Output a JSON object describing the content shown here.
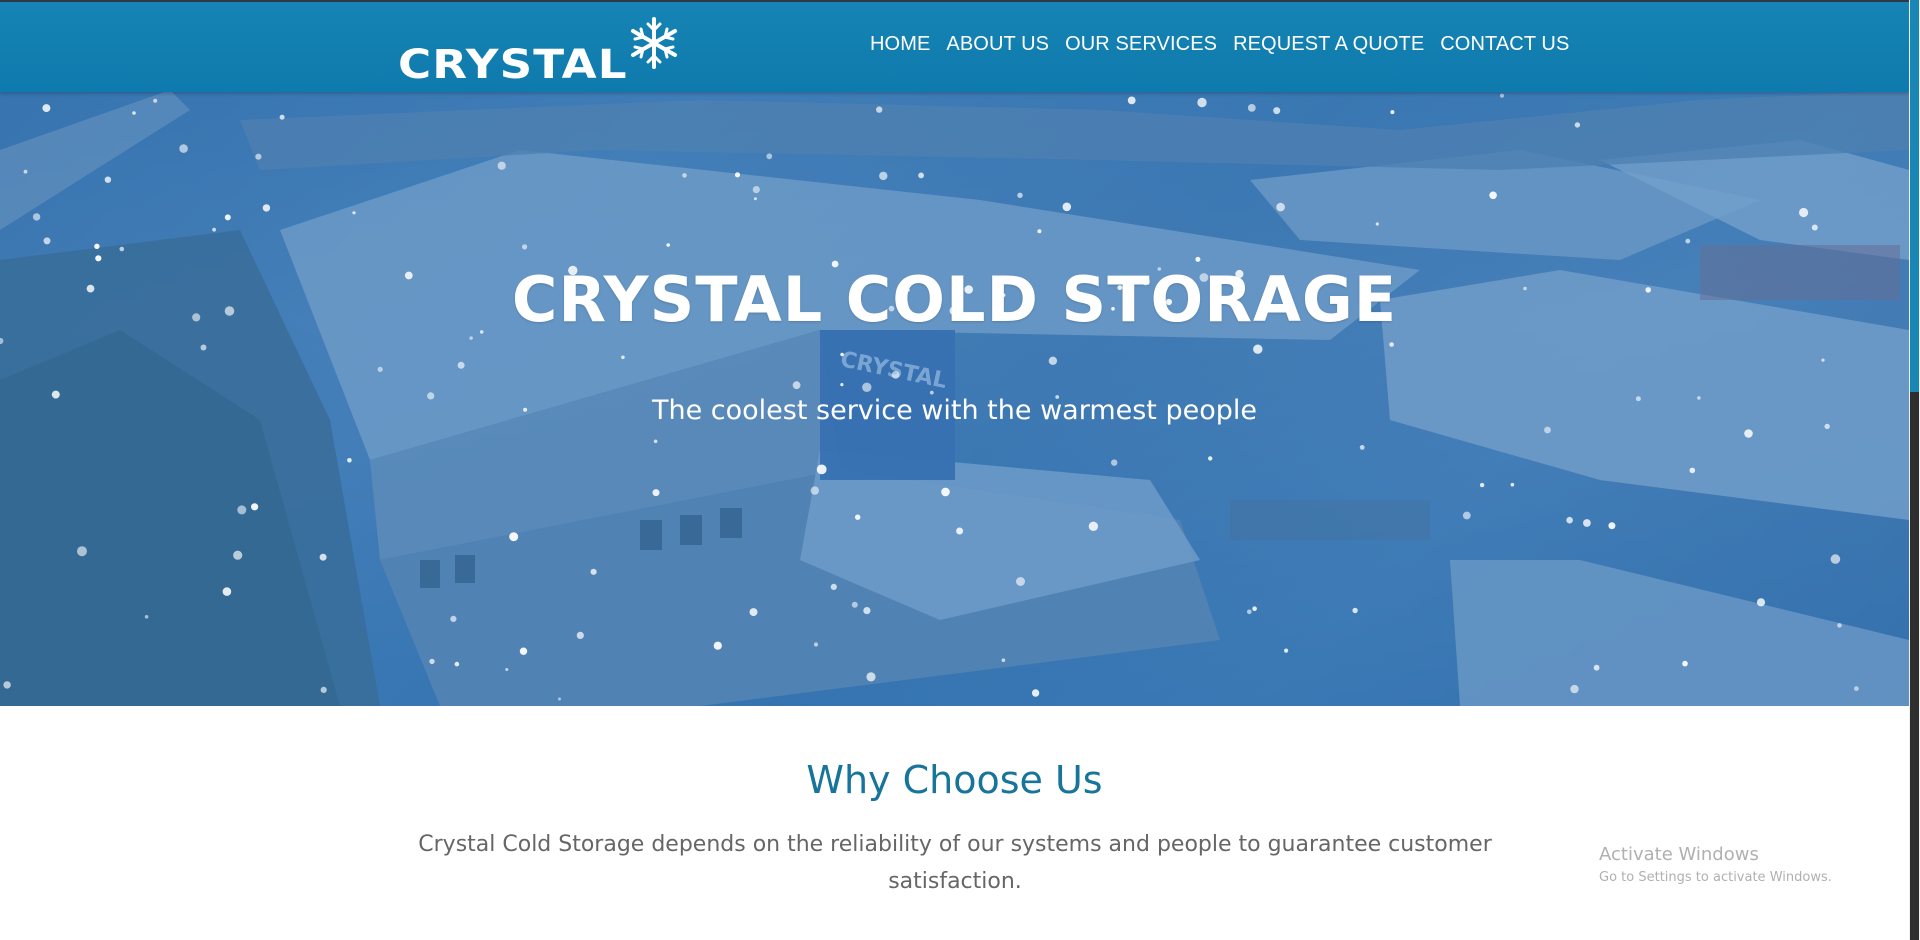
{
  "brand": {
    "logo_text": "CRYSTAL"
  },
  "nav": {
    "items": [
      {
        "label": "HOME"
      },
      {
        "label": "ABOUT US"
      },
      {
        "label": "OUR SERVICES"
      },
      {
        "label": "REQUEST A QUOTE"
      },
      {
        "label": "CONTACT US"
      }
    ]
  },
  "hero": {
    "title": "CRYSTAL COLD STORAGE",
    "subtitle": "The coolest service with the warmest people",
    "sign_text": "CRYSTAL"
  },
  "why": {
    "title": "Why Choose Us",
    "text": "Crystal Cold Storage depends on the reliability of our systems and people to guarantee customer satisfaction."
  },
  "watermark": {
    "line1": "Activate Windows",
    "line2": "Go to Settings to activate Windows."
  },
  "colors": {
    "header": "#1684b5",
    "accent": "#17749b",
    "hero_tint": "#3f7ab5"
  }
}
